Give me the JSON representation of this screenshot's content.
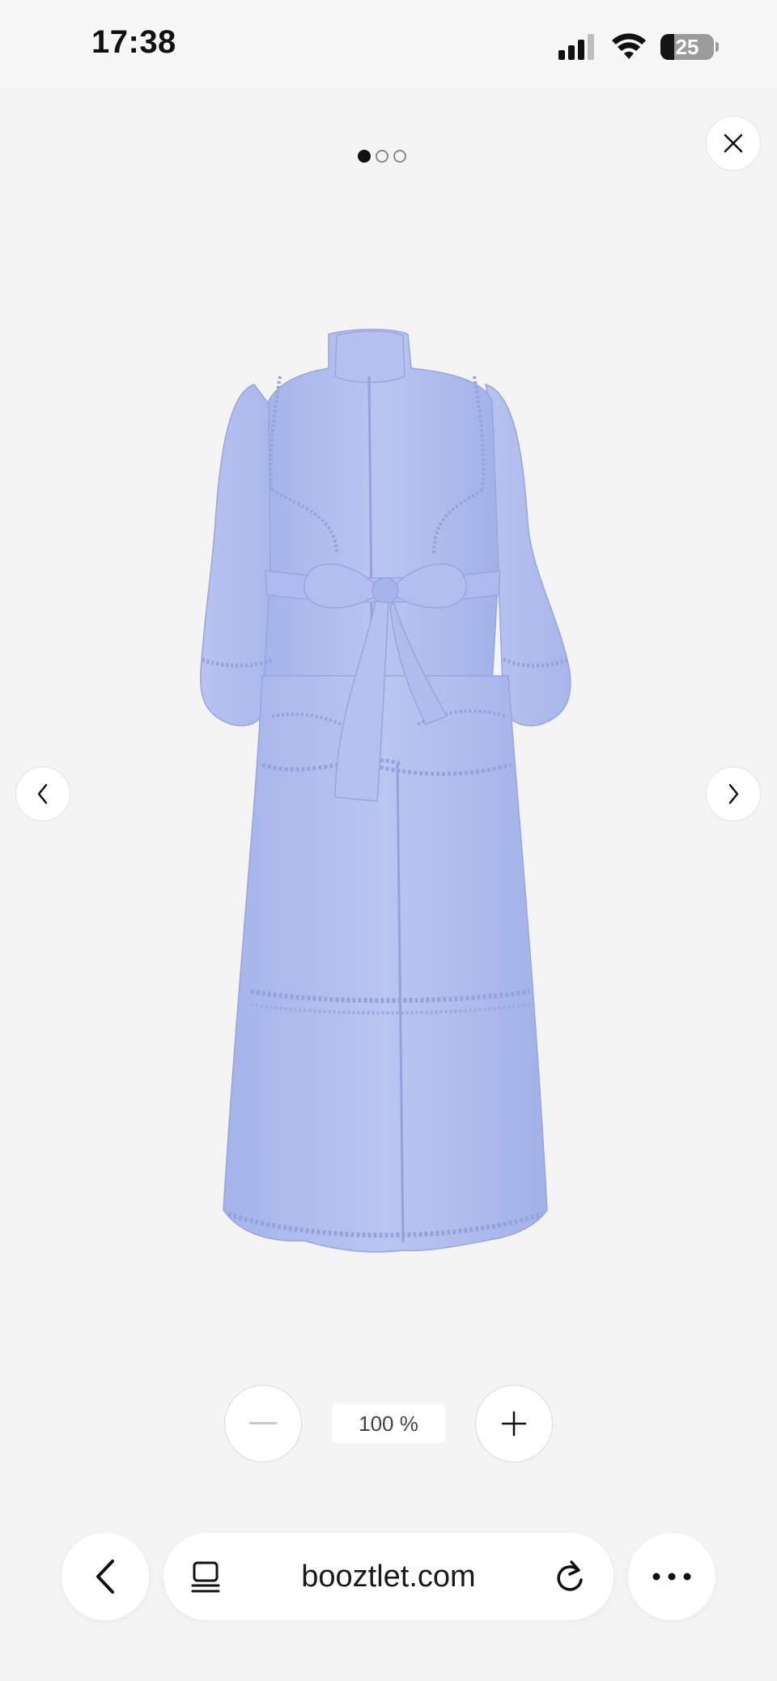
{
  "status_bar": {
    "time": "17:38",
    "battery_level": "25",
    "battery_fraction": 0.25,
    "icons": [
      "signal-icon",
      "wifi-icon",
      "battery-icon"
    ]
  },
  "gallery": {
    "page_count": 3,
    "current_page": 1,
    "close_icon": "close-icon",
    "prev_icon": "chevron-left-icon",
    "next_icon": "chevron-right-icon",
    "product_image": "light-blue-ruffled-maxi-dress",
    "product_color": "#b3c0ef"
  },
  "zoom": {
    "minus_icon": "minus-icon",
    "level": "100 %",
    "plus_icon": "plus-icon"
  },
  "browser": {
    "url": "booztlet.com",
    "back_icon": "back-arrow-icon",
    "tabs_icon": "tabs-icon",
    "reload_icon": "reload-icon",
    "more_icon": "more-icon"
  }
}
